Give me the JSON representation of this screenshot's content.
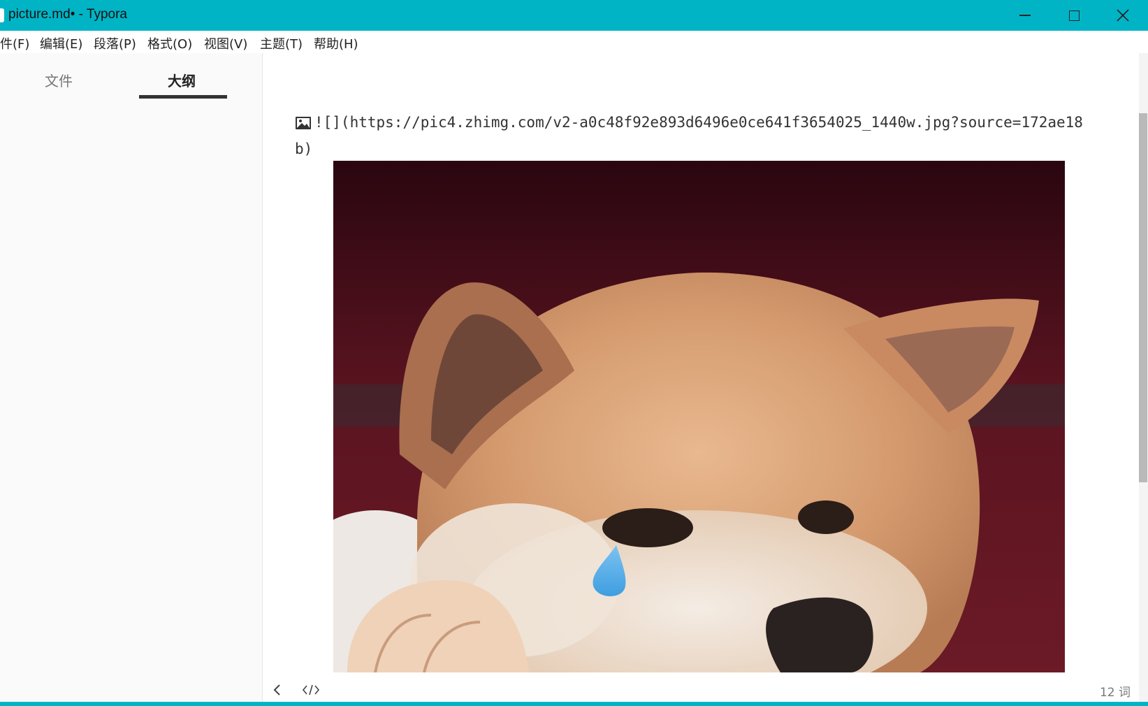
{
  "window": {
    "title": "picture.md• - Typora",
    "accent_color": "#00b4c6",
    "controls": [
      "minimize-icon",
      "maximize-icon",
      "close-icon"
    ]
  },
  "menubar": {
    "items": [
      "件(F)",
      "编辑(E)",
      "段落(P)",
      "格式(O)",
      "视图(V)",
      "主题(T)",
      "帮助(H)"
    ]
  },
  "sidebar": {
    "tabs": [
      {
        "label": "文件",
        "active": false
      },
      {
        "label": "大纲",
        "active": true
      }
    ]
  },
  "editor": {
    "markdown_source": "![](https://pic4.zhimg.com/v2-a0c48f92e893d6496e0ce641f3654025_1440w.jpg?source=172ae18b)",
    "image_description": "Shiba Inu dog with a teardrop"
  },
  "footer": {
    "word_count": "12 词"
  }
}
